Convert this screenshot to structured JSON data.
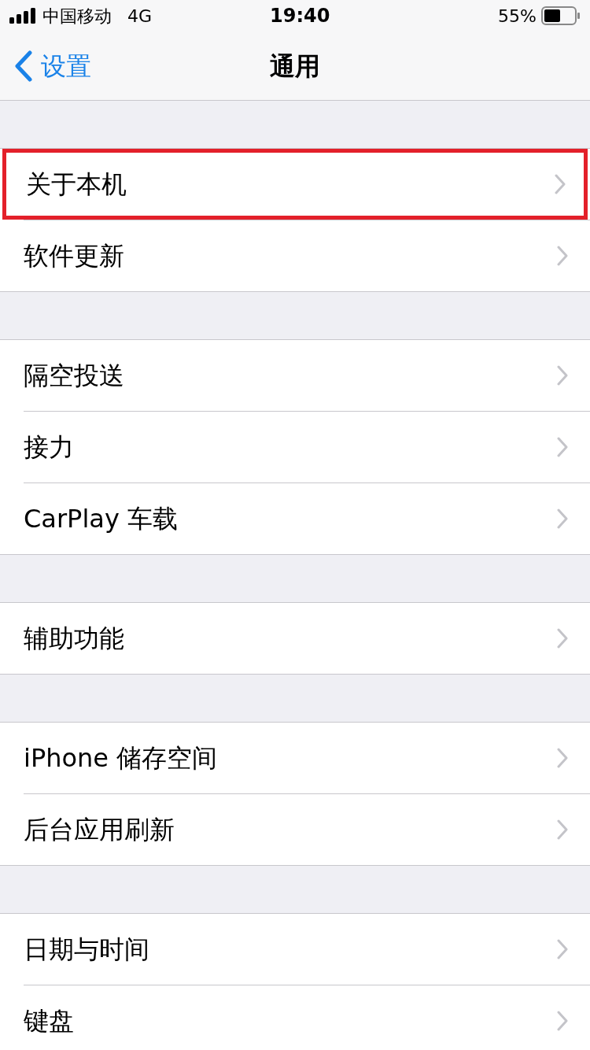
{
  "status_bar": {
    "carrier": "中国移动",
    "network": "4G",
    "time": "19:40",
    "battery": "55%"
  },
  "nav": {
    "back": "设置",
    "title": "通用"
  },
  "groups": [
    {
      "items": [
        {
          "label": "关于本机",
          "highlighted": true
        },
        {
          "label": "软件更新",
          "highlighted": false
        }
      ]
    },
    {
      "items": [
        {
          "label": "隔空投送",
          "highlighted": false
        },
        {
          "label": "接力",
          "highlighted": false
        },
        {
          "label": "CarPlay 车载",
          "highlighted": false
        }
      ]
    },
    {
      "items": [
        {
          "label": "辅助功能",
          "highlighted": false
        }
      ]
    },
    {
      "items": [
        {
          "label": "iPhone 储存空间",
          "highlighted": false
        },
        {
          "label": "后台应用刷新",
          "highlighted": false
        }
      ]
    },
    {
      "items": [
        {
          "label": "日期与时间",
          "highlighted": false
        },
        {
          "label": "键盘",
          "highlighted": false
        }
      ]
    }
  ]
}
